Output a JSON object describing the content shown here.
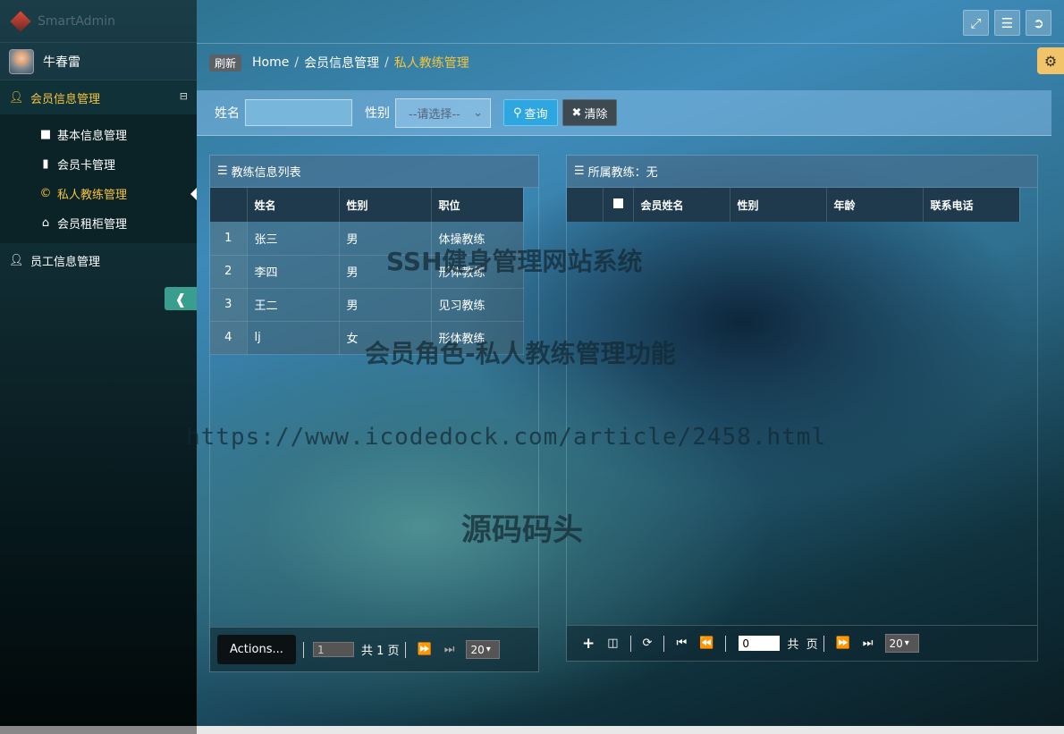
{
  "sidebar": {
    "logo": "SmartAdmin",
    "user": "牛春雷",
    "groups": [
      {
        "label": "会员信息管理",
        "icon": "user-icon",
        "collapse": "⊟"
      },
      {
        "label": "员工信息管理",
        "icon": "user-icon"
      }
    ],
    "items": [
      {
        "label": "基本信息管理",
        "icon": "folder-icon"
      },
      {
        "label": "会员卡管理",
        "icon": "book-icon"
      },
      {
        "label": "私人教练管理",
        "icon": "copyright-icon"
      },
      {
        "label": "会员租柜管理",
        "icon": "home-icon"
      }
    ]
  },
  "breadcrumb": {
    "refresh": "刷新",
    "home": "Home",
    "parent": "会员信息管理",
    "current": "私人教练管理"
  },
  "search": {
    "name_label": "姓名",
    "gender_label": "性别",
    "gender_placeholder": "--请选择--",
    "search_btn": "查询",
    "clear_btn": "清除"
  },
  "left_panel": {
    "title": "教练信息列表",
    "columns": [
      "姓名",
      "性别",
      "职位"
    ],
    "rows": [
      {
        "n": "1",
        "name": "张三",
        "gender": "男",
        "pos": "体操教练"
      },
      {
        "n": "2",
        "name": "李四",
        "gender": "男",
        "pos": "形体教练"
      },
      {
        "n": "3",
        "name": "王二",
        "gender": "男",
        "pos": "见习教练"
      },
      {
        "n": "4",
        "name": "lj",
        "gender": "女",
        "pos": "形体教练"
      }
    ],
    "pager": {
      "actions": "Actions...",
      "page": "1",
      "total": "共 1 页",
      "size": "20"
    }
  },
  "right_panel": {
    "title": "所属教练：无",
    "columns": [
      "会员姓名",
      "性别",
      "年龄",
      "联系电话"
    ],
    "pager": {
      "page": "0",
      "total": "共  页",
      "size": "20"
    }
  },
  "watermarks": [
    "SSH健身管理网站系统",
    "会员角色-私人教练管理功能",
    "https://www.icodedock.com/article/2458.html",
    "源码码头"
  ]
}
